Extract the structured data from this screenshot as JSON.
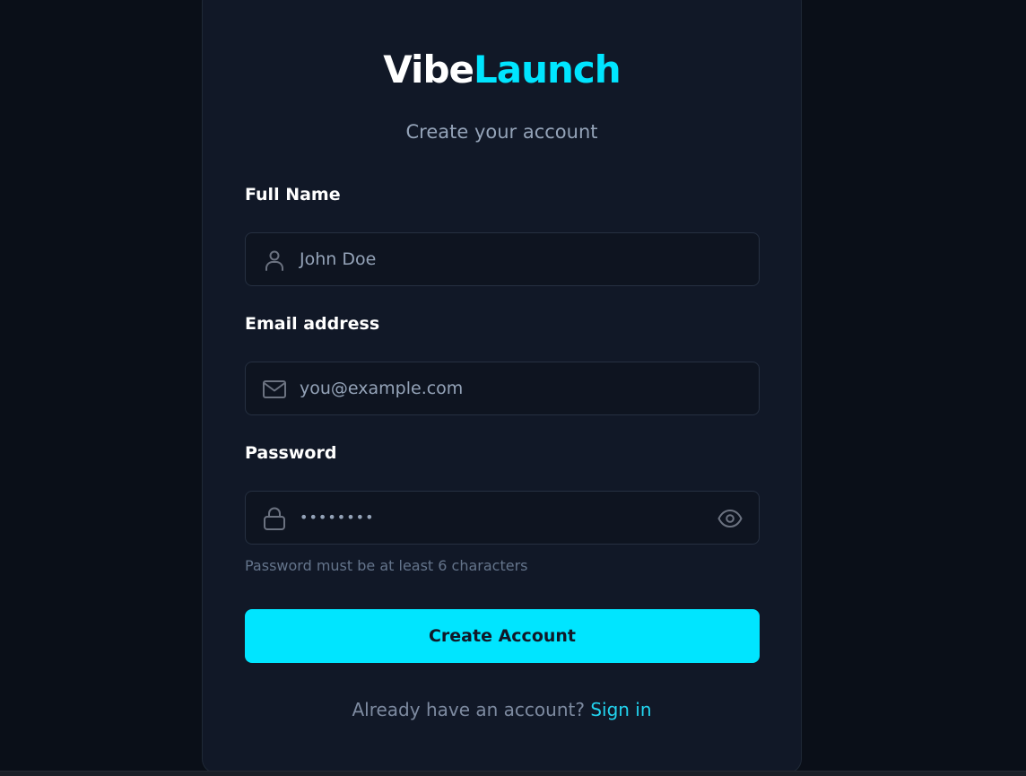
{
  "brand": {
    "part1": "Vibe",
    "part2": "Launch",
    "color_primary": "#ffffff",
    "color_accent": "#00e5ff"
  },
  "subtitle": "Create your account",
  "form": {
    "full_name": {
      "label": "Full Name",
      "placeholder": "John Doe",
      "icon": "user-icon"
    },
    "email": {
      "label": "Email address",
      "placeholder": "you@example.com",
      "icon": "mail-icon"
    },
    "password": {
      "label": "Password",
      "value": "••••••••",
      "icon": "lock-icon",
      "toggle_icon": "eye-icon",
      "hint": "Password must be at least 6 characters"
    },
    "submit_label": "Create Account"
  },
  "footer": {
    "prompt": "Already have an account?",
    "link_label": "Sign in"
  },
  "colors": {
    "background": "#0a0f18",
    "card": "#111827",
    "button": "#00e5ff",
    "link": "#22d3ee"
  }
}
